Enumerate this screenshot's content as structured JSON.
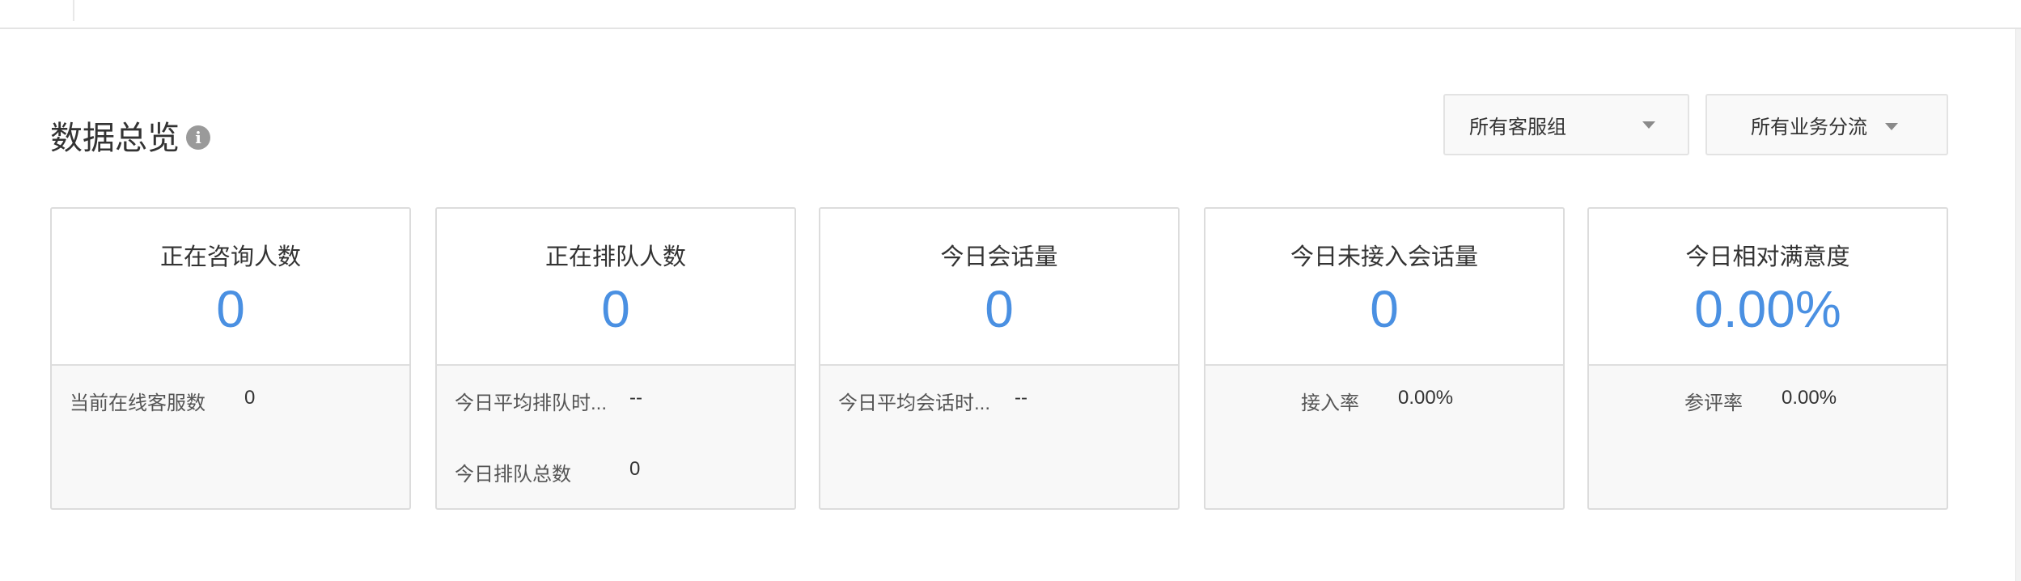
{
  "header": {
    "title": "数据总览",
    "info_icon": "info-icon"
  },
  "filters": {
    "group_select": "所有客服组",
    "flow_select": "所有业务分流"
  },
  "colors": {
    "accent": "#4a90e2",
    "border": "#dcdcdc",
    "panel_bg": "#f8f8f8"
  },
  "cards": [
    {
      "title": "正在咨询人数",
      "value": "0",
      "stats": [
        {
          "label": "当前在线客服数",
          "value": "0"
        }
      ]
    },
    {
      "title": "正在排队人数",
      "value": "0",
      "stats": [
        {
          "label": "今日平均排队时...",
          "value": "--"
        },
        {
          "label": "今日排队总数",
          "value": "0"
        }
      ]
    },
    {
      "title": "今日会话量",
      "value": "0",
      "stats": [
        {
          "label": "今日平均会话时...",
          "value": "--"
        }
      ]
    },
    {
      "title": "今日未接入会话量",
      "value": "0",
      "stats": [
        {
          "label": "接入率",
          "value": "0.00%"
        }
      ]
    },
    {
      "title": "今日相对满意度",
      "value": "0.00%",
      "stats": [
        {
          "label": "参评率",
          "value": "0.00%"
        }
      ]
    }
  ]
}
